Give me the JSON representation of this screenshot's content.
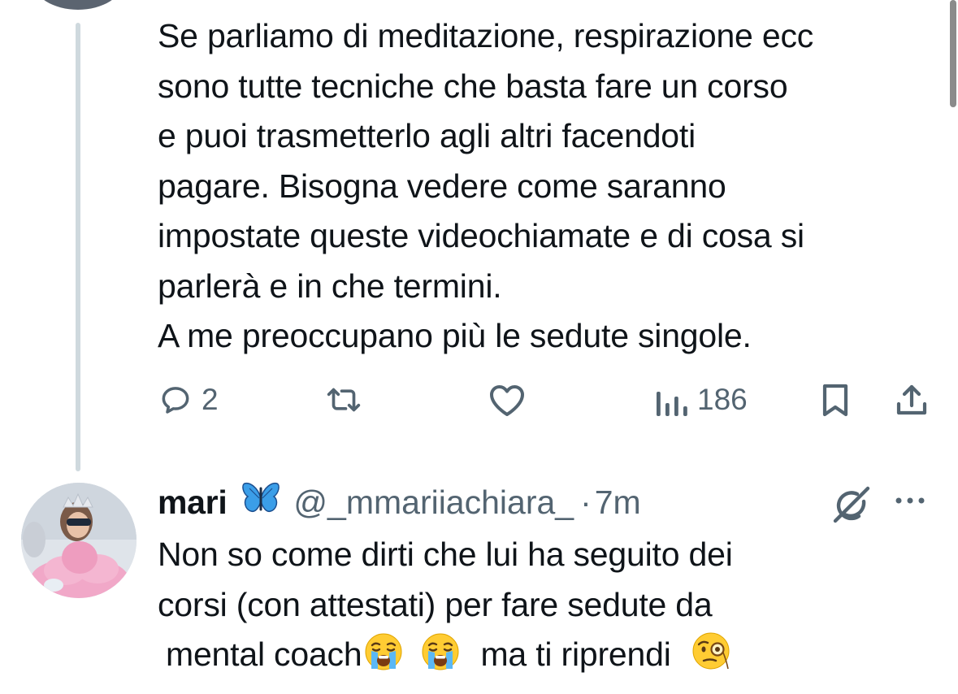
{
  "parent_tweet": {
    "text_lines": [
      "Se parliamo di meditazione, respirazione ecc",
      "sono tutte tecniche che basta fare un corso",
      "e puoi trasmetterlo agli altri facendoti",
      "pagare. Bisogna vedere come saranno",
      "impostate queste videochiamate e di cosa si",
      "parlerà e in che termini.",
      "A me preoccupano più le sedute singole."
    ],
    "actions": {
      "reply_count": "2",
      "retweet_count": "",
      "like_count": "",
      "views_count": "186"
    }
  },
  "reply_tweet": {
    "display_name": "mari",
    "handle": "@_mmariiachiara_",
    "separator": "·",
    "time": "7m",
    "text_line_1": "Non so come dirti che lui ha seguito dei",
    "text_line_2": "corsi (con attestati) per fare sedute da",
    "text_line_3_a": "mental coach",
    "text_line_3_b": "ma ti riprendi"
  },
  "icons": {
    "reply": "speech-bubble-icon",
    "retweet": "retweet-icon",
    "like": "heart-icon",
    "views": "bar-chart-icon",
    "bookmark": "bookmark-icon",
    "share": "share-icon",
    "grok": "grok-icon",
    "more": "more-dots-icon",
    "butterfly": "butterfly-emoji",
    "crying": "loudly-crying-face-emoji",
    "monocle": "face-with-monocle-emoji"
  },
  "colors": {
    "text": "#0f1419",
    "secondary": "#536471",
    "thread_line": "#cfd9de",
    "butterfly_blue": "#3b9ee8"
  }
}
